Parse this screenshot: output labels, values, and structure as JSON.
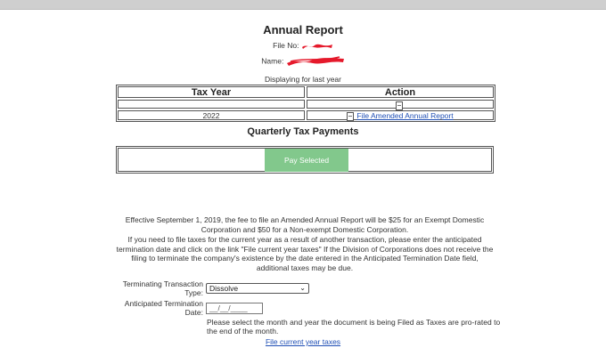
{
  "header": {
    "title": "Annual Report",
    "file_no_label": "File No:",
    "name_label": "Name:",
    "displaying": "Displaying for last year"
  },
  "report_table": {
    "columns": [
      "Tax Year",
      "Action"
    ],
    "rows": [
      {
        "tax_year": "2022",
        "action": "File Amended Annual Report"
      }
    ]
  },
  "quarterly": {
    "title": "Quarterly Tax Payments",
    "pay_button": "Pay Selected"
  },
  "notice": {
    "line1": "Effective September 1, 2019, the fee to file an Amended Annual Report will be $25 for an Exempt Domestic Corporation and $50 for a Non-exempt Domestic Corporation.",
    "line2": "If you need to file taxes for the current year as a result of another transaction, please enter the anticipated termination date and click on the link \"File current year taxes\" If the Division of Corporations does not receive the filing to terminate the company's existence by the date entered in the Anticipated Termination Date field, additional taxes may be due."
  },
  "form": {
    "transaction_type_label_1": "Terminating Transaction",
    "transaction_type_label_2": "Type:",
    "transaction_type_value": "Dissolve",
    "termination_date_label_1": "Anticipated Termination",
    "termination_date_label_2": "Date:",
    "termination_date_placeholder": "__/__/____",
    "note": "Please select the month and year the document is being Filed as Taxes are pro-rated to the end of the month.",
    "submit_link": "File current year taxes"
  },
  "colors": {
    "link": "#1f4fb5",
    "pay_button_bg": "#82c88c",
    "redaction": "#e5192b"
  }
}
